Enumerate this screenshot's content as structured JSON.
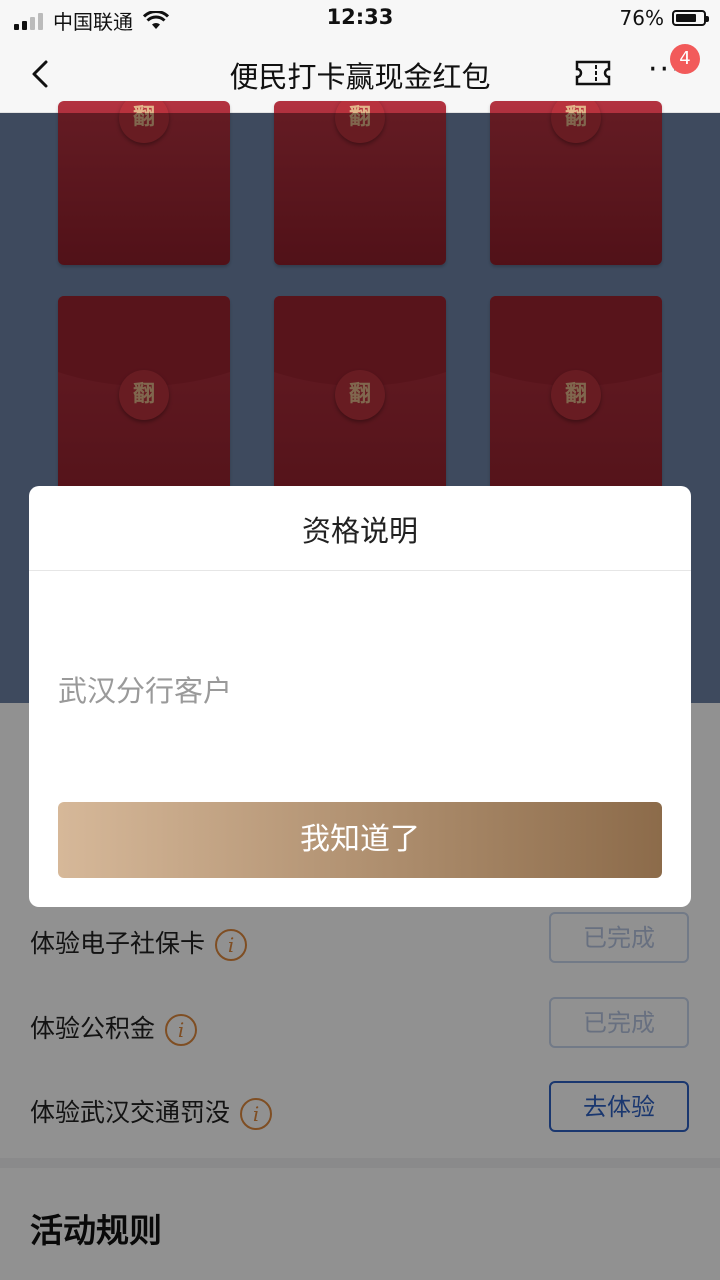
{
  "status_bar": {
    "carrier": "中国联通",
    "time": "12:33",
    "battery_percent": "76%",
    "battery_level": 0.76,
    "signal_bars": 2
  },
  "nav": {
    "back_icon": "chevron-left-icon",
    "title": "便民打卡赢现金红包",
    "ticket_icon": "ticket-icon",
    "more_icon": "more-icon",
    "more_label": "···",
    "badge_count": "4"
  },
  "envelopes": {
    "label": "翻",
    "colors": {
      "envelope": "#a72a36",
      "seal_text": "#e2b58a",
      "background": "#6d83a6"
    }
  },
  "tasks": [
    {
      "label": "体验电子社保卡",
      "info_icon": "i",
      "button": "已完成",
      "state": "done"
    },
    {
      "label": "体验公积金",
      "info_icon": "i",
      "button": "已完成",
      "state": "done"
    },
    {
      "label": "体验武汉交通罚没",
      "info_icon": "i",
      "button": "去体验",
      "state": "go"
    }
  ],
  "rules": {
    "title": "活动规则"
  },
  "modal": {
    "title": "资格说明",
    "body": "武汉分行客户",
    "button": "我知道了",
    "button_gradient": [
      "#d6b899",
      "#8c6b4a"
    ]
  }
}
